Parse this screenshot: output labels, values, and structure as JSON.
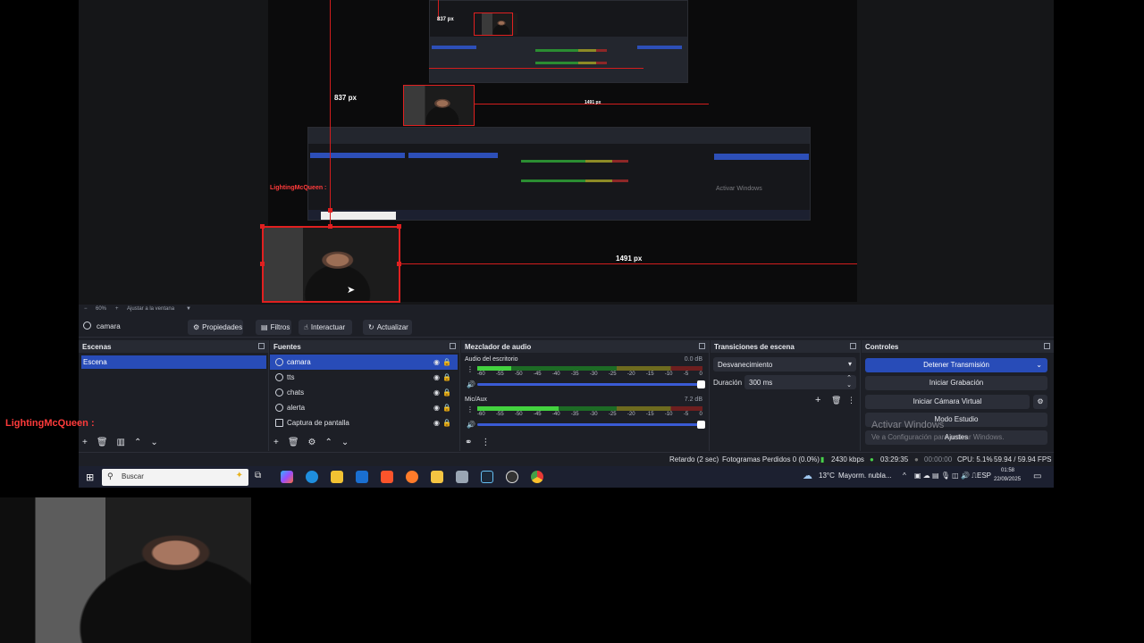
{
  "preview": {
    "label_height": "837 px",
    "label_width": "1491 px",
    "nested_label": "1491 px",
    "nested_user": "LightingMcQueen :",
    "zoom": "60%",
    "fit": "Ajustar a la ventana"
  },
  "source_toolbar": {
    "source_name": "camara",
    "properties": "Propiedades",
    "filters": "Filtros",
    "interact": "Interactuar",
    "refresh": "Actualizar"
  },
  "scenes": {
    "title": "Escenas",
    "items": [
      "Escena"
    ]
  },
  "sources": {
    "title": "Fuentes",
    "items": [
      {
        "name": "camara"
      },
      {
        "name": "tts"
      },
      {
        "name": "chats"
      },
      {
        "name": "alerta"
      },
      {
        "name": "Captura de pantalla"
      }
    ]
  },
  "mixer": {
    "title": "Mezclador de audio",
    "channels": [
      {
        "name": "Audio del escritorio",
        "db": "0.0 dB",
        "level": 0.15
      },
      {
        "name": "Mic/Aux",
        "db": "7.2 dB",
        "level": 0.36
      }
    ],
    "scale": [
      "-60",
      "-55",
      "-50",
      "-45",
      "-40",
      "-35",
      "-30",
      "-25",
      "-20",
      "-15",
      "-10",
      "-5",
      "0"
    ]
  },
  "transitions": {
    "title": "Transiciones de escena",
    "selected": "Desvanecimiento",
    "duration_label": "Duración",
    "duration_value": "300 ms"
  },
  "controls": {
    "title": "Controles",
    "stop_stream": "Detener Transmisión",
    "start_recording": "Iniciar Grabación",
    "virtual_cam": "Iniciar Cámara Virtual",
    "studio_mode": "Modo Estudio",
    "settings": "Ajustes"
  },
  "watermark": {
    "line1": "Activar Windows",
    "line2": "Ve a Configuración para activar Windows."
  },
  "status": {
    "delay": "Retardo (2 sec)",
    "dropped": "Fotogramas Perdidos 0 (0.0%)",
    "bitrate": "2430 kbps",
    "stream_time": "03:29:35",
    "rec_time": "00:00:00",
    "cpu": "CPU: 5.1%",
    "fps": "59.94 / 59.94 FPS"
  },
  "taskbar": {
    "search_placeholder": "Buscar",
    "weather_temp": "13°C",
    "weather_text": "Mayorm. nubla...",
    "lang": "ESP",
    "time": "01:58",
    "date": "22/09/2025"
  },
  "chat": {
    "user": "LightingMcQueen :"
  },
  "colors": {
    "accent": "#284cb8",
    "red_guide": "#d21d1d",
    "chat_name": "#ff3b3b"
  }
}
